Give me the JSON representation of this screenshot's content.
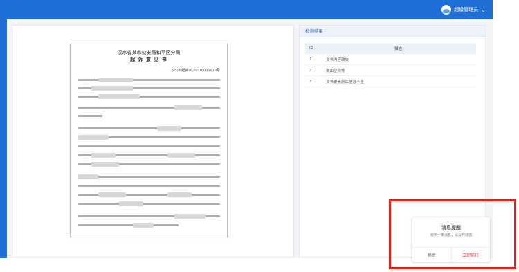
{
  "header": {
    "username": "超级管理员",
    "colors": {
      "primary": "#1f6fd6",
      "highlight": "#e0201c"
    }
  },
  "document": {
    "heading_line1": "汉水省某市公安局和平区分局",
    "heading_line2": "起 诉 意 见 书",
    "doc_number": "汉公和起诉字[2019]000018号"
  },
  "result": {
    "title": "检测结果",
    "columns": [
      "ID",
      "描述"
    ],
    "rows": [
      {
        "id": "1",
        "desc": "文书内容缺失"
      },
      {
        "id": "2",
        "desc": "案由空白等"
      },
      {
        "id": "3",
        "desc": "文书要素前后信息不全"
      }
    ]
  },
  "toast": {
    "title": "消息提醒",
    "message": "收到一条消息，请及时处理",
    "later": "稍后",
    "go": "立即前往"
  }
}
